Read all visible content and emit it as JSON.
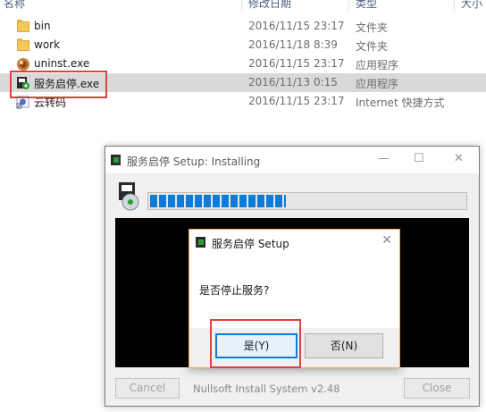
{
  "explorer": {
    "columns": {
      "name": "名称",
      "date": "修改日期",
      "type": "类型",
      "size": "大小"
    },
    "files": [
      {
        "name": "bin",
        "date": "2016/11/15 23:17",
        "type": "文件夹",
        "icon": "folder-icon"
      },
      {
        "name": "work",
        "date": "2016/11/18 8:39",
        "type": "文件夹",
        "icon": "folder-icon"
      },
      {
        "name": "uninst.exe",
        "date": "2016/11/15 23:17",
        "type": "应用程序",
        "icon": "uninstaller-icon"
      },
      {
        "name": "服务启停.exe",
        "date": "2016/11/13 0:15",
        "type": "应用程序",
        "icon": "installer-app-icon",
        "selected": true
      },
      {
        "name": "云转码",
        "date": "2016/11/15 23:17",
        "type": "Internet 快捷方式",
        "icon": "internet-shortcut-icon"
      }
    ]
  },
  "installer": {
    "title": "服务启停 Setup: Installing",
    "controls": {
      "minimize": "—",
      "maximize": "☐",
      "close": "✕"
    },
    "progress_fraction": 0.43,
    "cancel_label": "Cancel",
    "branding": "Nullsoft Install System v2.48",
    "close_label": "Close"
  },
  "dialog": {
    "title": "服务启停 Setup",
    "close": "✕",
    "message": "是否停止服务?",
    "yes_label": "是(Y)",
    "no_label": "否(N)"
  },
  "colors": {
    "highlight": "#e04040",
    "progress": "#0f7bd8",
    "selection": "#d9d9d9",
    "dialog_border": "#f5a453"
  }
}
